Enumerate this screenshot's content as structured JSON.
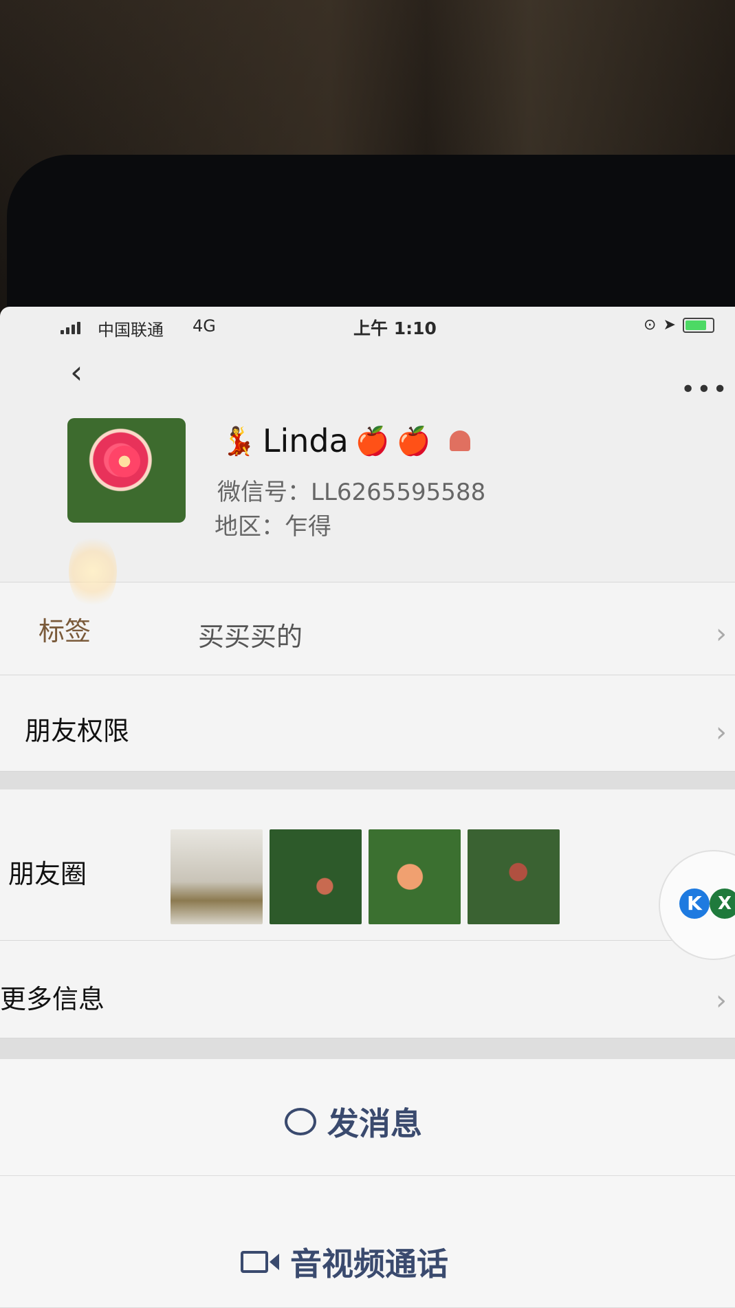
{
  "status_bar": {
    "carrier": "中国联通",
    "network": "4G",
    "time": "上午 1:10"
  },
  "profile": {
    "name": "Linda",
    "wechat_id": "微信号：LL6265595588",
    "region": "地区：乍得",
    "name_emojis": [
      "💃",
      "🍎",
      "🍎"
    ]
  },
  "rows": {
    "tags": {
      "label": "标签",
      "value": "买买买的"
    },
    "permissions": {
      "label": "朋友权限"
    },
    "moments": {
      "label": "朋友圈"
    },
    "more_info": {
      "label": "更多信息"
    }
  },
  "floating": {
    "k": "K",
    "x": "X"
  },
  "actions": {
    "message": "发消息",
    "call": "音视频通话"
  },
  "icons": {
    "back": "chevron-left-icon",
    "more": "more-icon",
    "chevron": "chevron-right-icon"
  },
  "colors": {
    "action_text": "#3a4a6e",
    "background": "#efefef"
  }
}
